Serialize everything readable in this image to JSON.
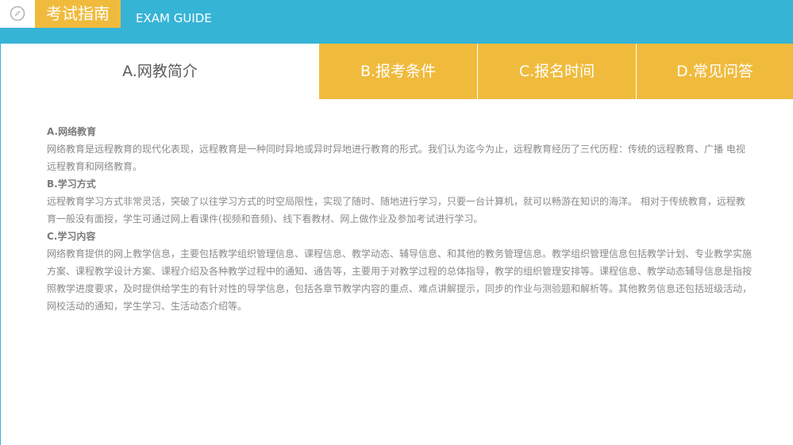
{
  "header": {
    "title": "考试指南",
    "subtitle": "EXAM GUIDE",
    "icon": "compass-icon",
    "bg_color": "#36b4d6",
    "accent_color": "#f0bb3d"
  },
  "tabs": [
    {
      "label": "A.网教简介",
      "active": true
    },
    {
      "label": "B.报考条件",
      "active": false
    },
    {
      "label": "C.报名时间",
      "active": false
    },
    {
      "label": "D.常见问答",
      "active": false
    }
  ],
  "sections": [
    {
      "heading": "A.网络教育",
      "body": "网络教育是远程教育的现代化表现，远程教育是一种同时异地或异时异地进行教育的形式。我们认为迄今为止，远程教育经历了三代历程：传统的远程教育、广播 电视远程教育和网络教育。"
    },
    {
      "heading": "B.学习方式",
      "body": "远程教育学习方式非常灵活，突破了以往学习方式的时空局限性，实现了随时、随地进行学习，只要一台计算机，就可以畅游在知识的海洋。 相对于传统教育，远程教育一般没有面授，学生可通过网上看课件(视频和音频)、线下看教材、网上做作业及参加考试进行学习。"
    },
    {
      "heading": "C.学习内容",
      "body": "网络教育提供的网上教学信息，主要包括教学组织管理信息、课程信息、教学动态、辅导信息、和其他的教务管理信息。教学组织管理信息包括教学计划、专业教学实施方案、课程教学设计方案、课程介绍及各种教学过程中的通知、通告等，主要用于对教学过程的总体指导，教学的组织管理安排等。课程信息、教学动态辅导信息是指按照教学进度要求，及时提供给学生的有针对性的导学信息，包括各章节教学内容的重点、难点讲解提示，同步的作业与测验题和解析等。其他教务信息还包括班级活动，网校活动的通知，学生学习、生活动态介绍等。"
    }
  ]
}
